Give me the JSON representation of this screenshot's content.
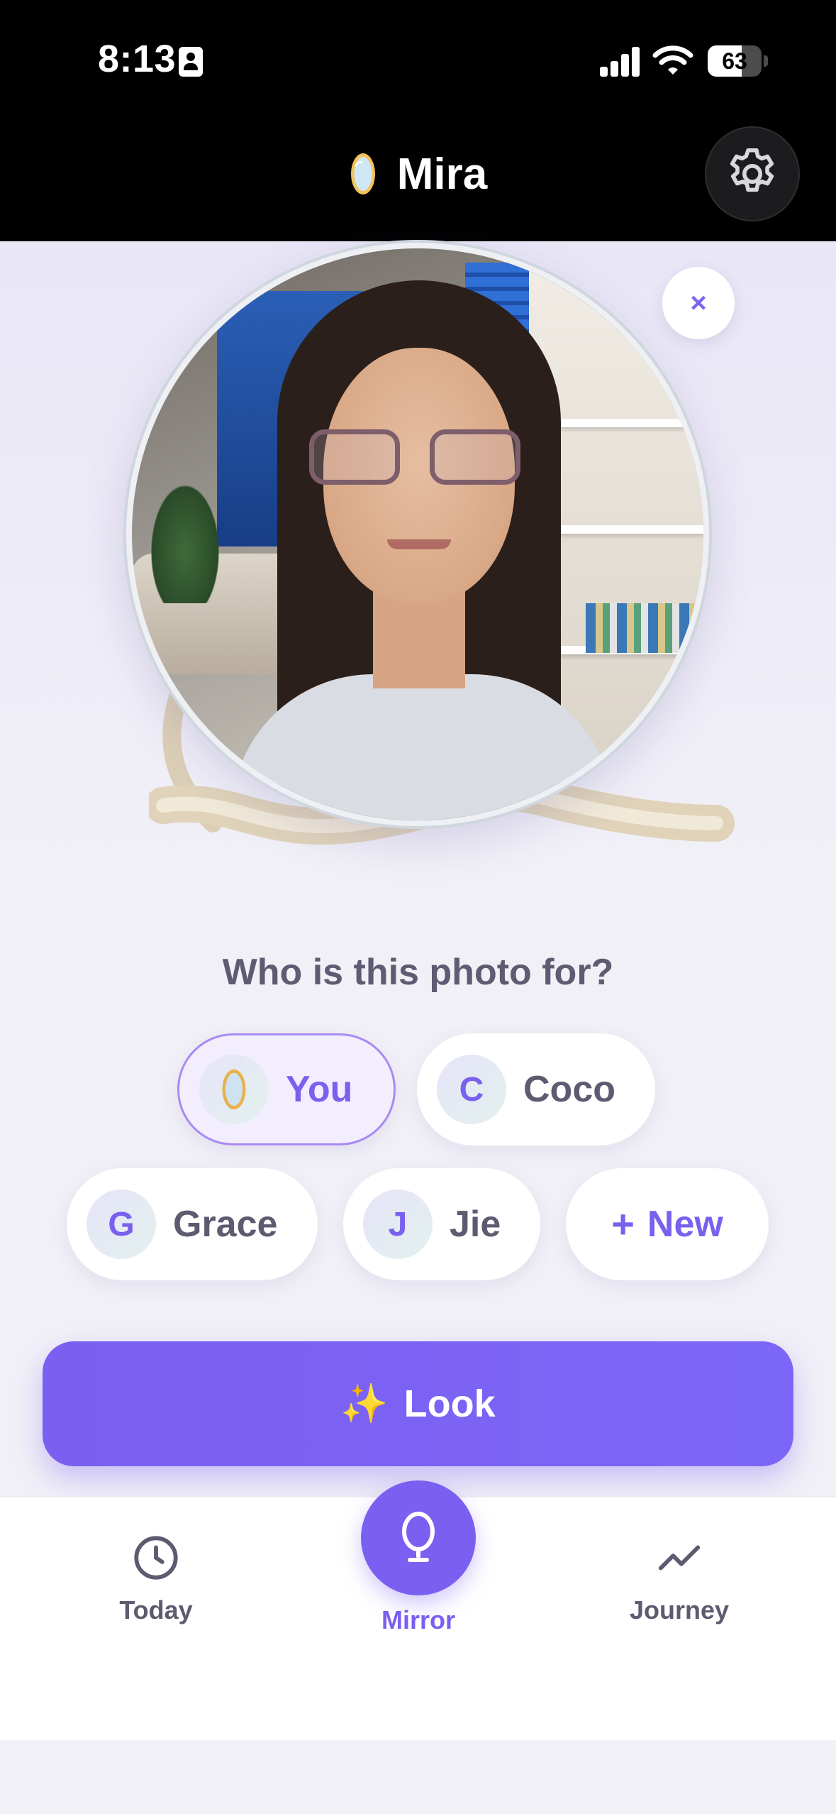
{
  "status_bar": {
    "time": "8:13",
    "battery": "63",
    "battery_level": 0.63,
    "icons": [
      "contact-card-icon",
      "signal-icon",
      "wifi-icon",
      "battery-icon"
    ]
  },
  "header": {
    "title": "Mira",
    "logo_icon": "mirror-icon",
    "settings_icon": "gear-icon"
  },
  "photo": {
    "close_label": "×"
  },
  "prompt": {
    "question": "Who is this photo for?"
  },
  "people": [
    {
      "avatar": "",
      "avatar_icon": "mirror-icon",
      "label": "You",
      "selected": true
    },
    {
      "avatar": "C",
      "label": "Coco",
      "selected": false
    },
    {
      "avatar": "G",
      "label": "Grace",
      "selected": false
    },
    {
      "avatar": "J",
      "label": "Jie",
      "selected": false
    }
  ],
  "new_person": {
    "plus": "+",
    "label": "New"
  },
  "look_button": {
    "icon": "✨",
    "label": "Look"
  },
  "tabs": [
    {
      "label": "Today",
      "icon": "clock-icon",
      "active": false
    },
    {
      "label": "Mirror",
      "icon": "mirror-icon",
      "active": true
    },
    {
      "label": "Journey",
      "icon": "trend-icon",
      "active": false
    }
  ],
  "colors": {
    "accent": "#7b5ff0",
    "background": "#f1f0f7",
    "header": "#000000",
    "text_muted": "#5d5b70"
  }
}
